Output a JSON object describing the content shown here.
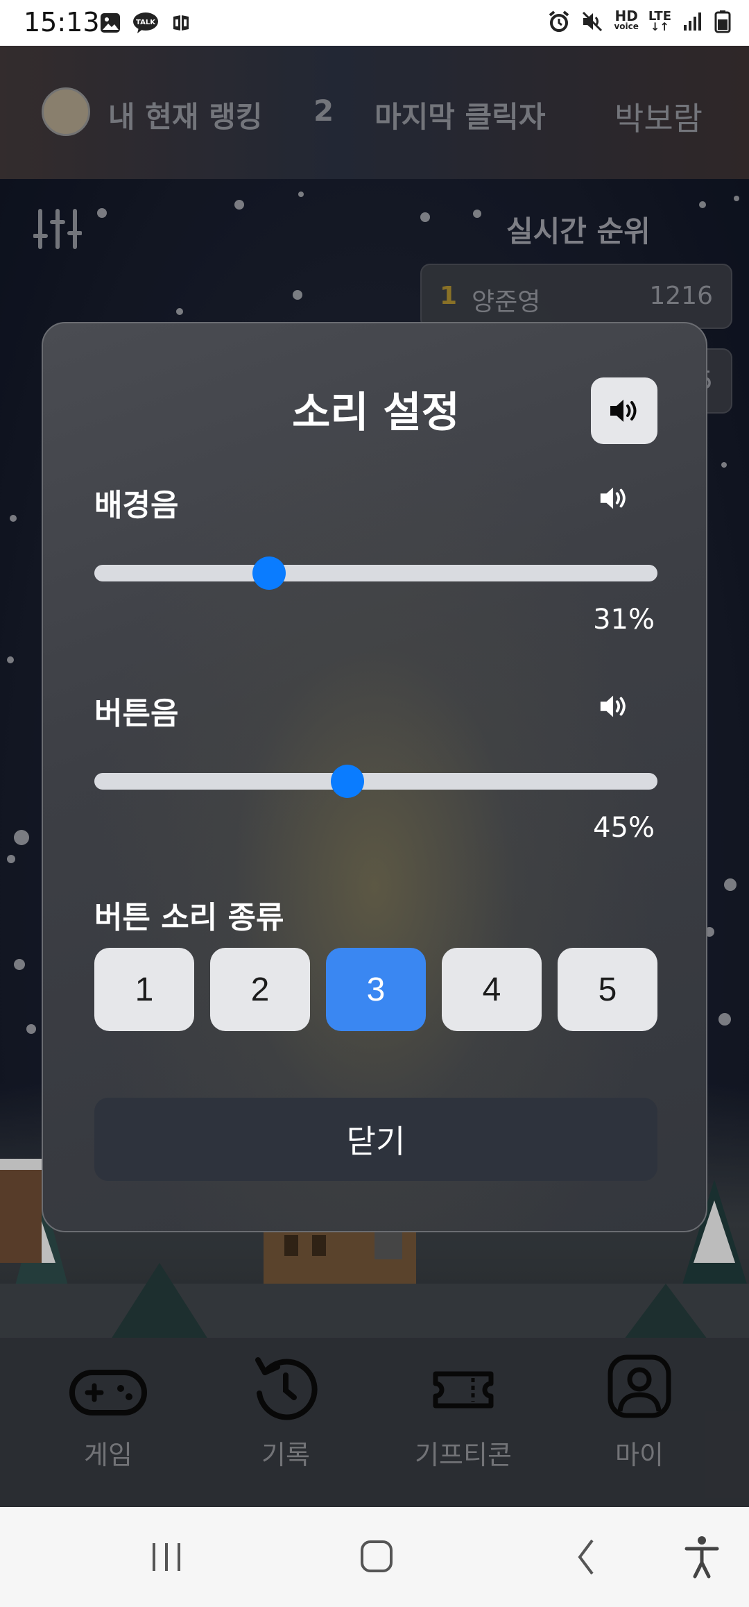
{
  "status_bar": {
    "time": "15:13",
    "left_icons": [
      "image-icon",
      "talk-icon",
      "app-icon"
    ],
    "talk_label": "TALK",
    "hd_label": "HD",
    "voice_label": "voice",
    "lte_label": "LTE"
  },
  "header": {
    "my_rank_label": "내 현재 랭킹",
    "my_rank_value": "2",
    "last_clicker_label": "마지막 클릭자",
    "last_clicker_name": "박보람"
  },
  "realtime": {
    "title": "실시간 순위",
    "entries": [
      {
        "rank": "1",
        "name": "양준영",
        "score": "1216"
      },
      {
        "rank": "",
        "name": "",
        "score": "5"
      }
    ]
  },
  "modal": {
    "title": "소리 설정",
    "bgm": {
      "label": "배경음",
      "value": 31,
      "value_text": "31%"
    },
    "button_sound": {
      "label": "버튼음",
      "value": 45,
      "value_text": "45%"
    },
    "sound_type": {
      "label": "버튼 소리 종류",
      "options": [
        "1",
        "2",
        "3",
        "4",
        "5"
      ],
      "selected": "3"
    },
    "close_label": "닫기"
  },
  "bottom_nav": {
    "items": [
      {
        "label": "게임",
        "icon": "gamepad-icon"
      },
      {
        "label": "기록",
        "icon": "history-icon"
      },
      {
        "label": "기프티콘",
        "icon": "ticket-icon"
      },
      {
        "label": "마이",
        "icon": "user-icon"
      }
    ]
  },
  "colors": {
    "accent_blue": "#0a7cff",
    "selected_button": "#3a87f2",
    "modal_bg": "#3d3f45"
  }
}
